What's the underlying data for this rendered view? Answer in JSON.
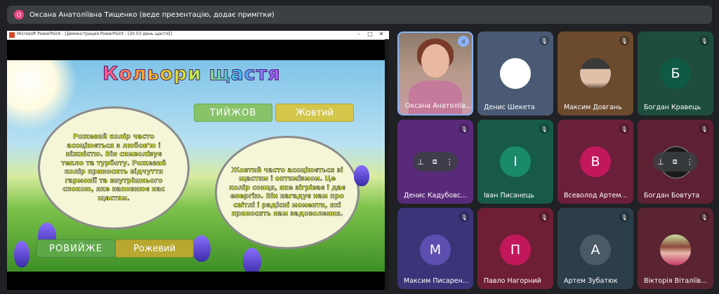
{
  "top_bar": {
    "avatar_initial": "О",
    "title": "Оксана Анатоліївна Тищенко (веде презентацію, додає примітки)"
  },
  "ppt_window": {
    "title": "Microsoft PowerPoint - [Демонстрация PowerPoint - [20.03 день щастя]]",
    "controls": [
      "–",
      "□",
      "✕"
    ]
  },
  "slide": {
    "title": "Кольори щастя",
    "word_top": "ТИЙЖОВ",
    "word_top_answer": "Жовтий",
    "word_bottom": "РОВИЙЖЕ",
    "word_bottom_answer": "Рожевий",
    "bubble_left": "Рожевий колір часто асоціюється з любов'ю і ніжністю. Він символізує тепло та турботу. Рожевий колір приносить відчуття гармонії та внутрішнього спокою, яке наповнює нас щастям.",
    "bubble_right": "Жовтий часто асоціюється зі щастям і оптимізмом. Це колір сонця, яке зігріває і дає енергію. Він нагадує нам про світлі і радісні моменти, які приносять нам задоволення."
  },
  "participants": [
    {
      "name": "Оксана Анатоліїв...",
      "kind": "video",
      "mic": "speaking"
    },
    {
      "name": "Денис Шекета",
      "kind": "blank",
      "mic": "muted",
      "color": "#4a5a74"
    },
    {
      "name": "Максим Довгань",
      "kind": "photo",
      "mic": "muted",
      "color": "#6b4a2e"
    },
    {
      "name": "Богдан Кравець",
      "initial": "Б",
      "kind": "initial",
      "mic": "muted",
      "color": "#1e4d3e",
      "circle": "#0f5a45"
    },
    {
      "name": "Денис Кадубовс...",
      "kind": "hover",
      "mic": "muted",
      "color": "#5a2a7a"
    },
    {
      "name": "Іван Писанець",
      "initial": "І",
      "kind": "initial",
      "mic": "muted",
      "color": "#175a4a",
      "circle": "#1a8a6a"
    },
    {
      "name": "Всеволод Артем...",
      "initial": "В",
      "kind": "initial",
      "mic": "muted",
      "color": "#6a1f3a",
      "circle": "#c2185b"
    },
    {
      "name": "Богдан Бовтута",
      "kind": "hover",
      "mic": "muted",
      "color": "#5e2033"
    },
    {
      "name": "Максим Писарен...",
      "initial": "М",
      "kind": "initial",
      "mic": "muted",
      "color": "#3a3478",
      "circle": "#5c4fb0"
    },
    {
      "name": "Павло Нагорний",
      "initial": "П",
      "kind": "initial",
      "mic": "muted",
      "color": "#6e1f35",
      "circle": "#c2185b"
    },
    {
      "name": "Артем Зубатюк",
      "initial": "А",
      "kind": "initial",
      "mic": "muted",
      "color": "#2c3e4a",
      "circle": "#4a5b66"
    },
    {
      "name": "Вікторія Віталіїв...",
      "kind": "photo",
      "mic": "muted",
      "color": "#5a2433"
    }
  ]
}
